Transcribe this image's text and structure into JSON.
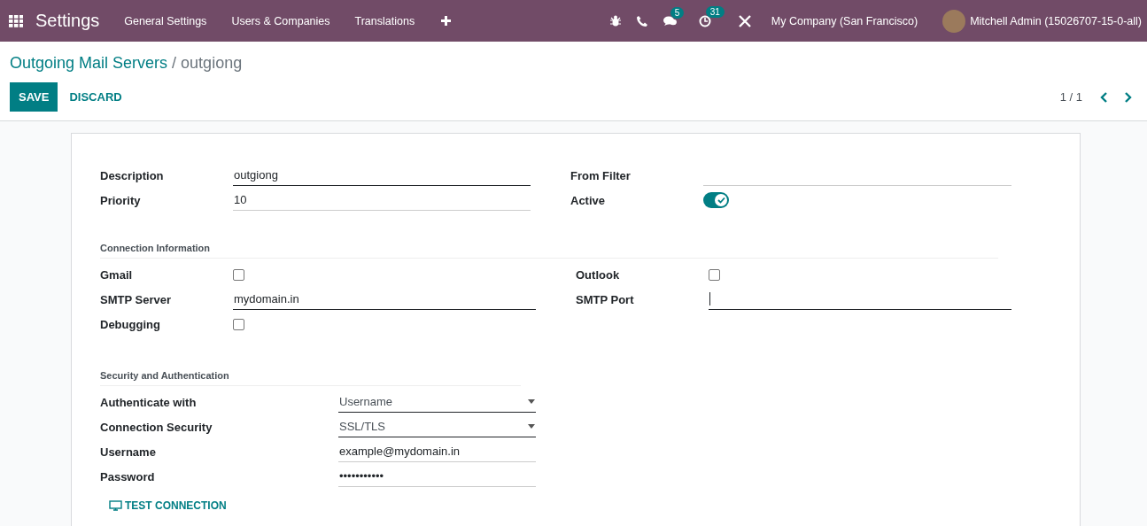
{
  "navbar": {
    "app_title": "Settings",
    "menu": [
      "General Settings",
      "Users & Companies",
      "Translations"
    ],
    "messages_badge": "5",
    "activities_badge": "31",
    "company": "My Company (San Francisco)",
    "user": "Mitchell Admin (15026707-15-0-all)"
  },
  "breadcrumb": {
    "parent": "Outgoing Mail Servers",
    "separator": "/",
    "current": "outgiong"
  },
  "actions": {
    "save": "SAVE",
    "discard": "DISCARD",
    "pager": "1 / 1"
  },
  "sections": [
    {
      "left": [
        {
          "kind": "field",
          "label": "Description",
          "value": "outgiong",
          "required": true
        },
        {
          "kind": "field",
          "label": "Priority",
          "value": "10",
          "required": false
        }
      ],
      "right": [
        {
          "kind": "field",
          "label": "From Filter",
          "required": false
        },
        {
          "kind": "toggle",
          "label": "Active",
          "on": true
        }
      ]
    },
    {
      "title": "Connection Information",
      "left": [
        {
          "kind": "checkbox",
          "label": "Gmail",
          "checked": false
        },
        {
          "kind": "field",
          "label": "SMTP Server",
          "value": "mydomain.in",
          "required": true
        },
        {
          "kind": "checkbox",
          "label": "Debugging",
          "checked": false
        }
      ],
      "right": [
        {
          "kind": "checkbox",
          "label": "Outlook",
          "checked": false
        },
        {
          "kind": "field",
          "label": "SMTP Port",
          "required": true,
          "focused": true
        }
      ]
    },
    {
      "title": "Security and Authentication",
      "left": [
        {
          "kind": "select",
          "label": "Authenticate with",
          "value": "Username"
        },
        {
          "kind": "select",
          "label": "Connection Security",
          "value": "SSL/TLS"
        },
        {
          "kind": "field",
          "label": "Username",
          "value": "example@mydomain.in",
          "required": false
        },
        {
          "kind": "field",
          "label": "Password",
          "value": "•••••••••••",
          "required": false
        }
      ]
    }
  ],
  "test_button": "TEST CONNECTION"
}
